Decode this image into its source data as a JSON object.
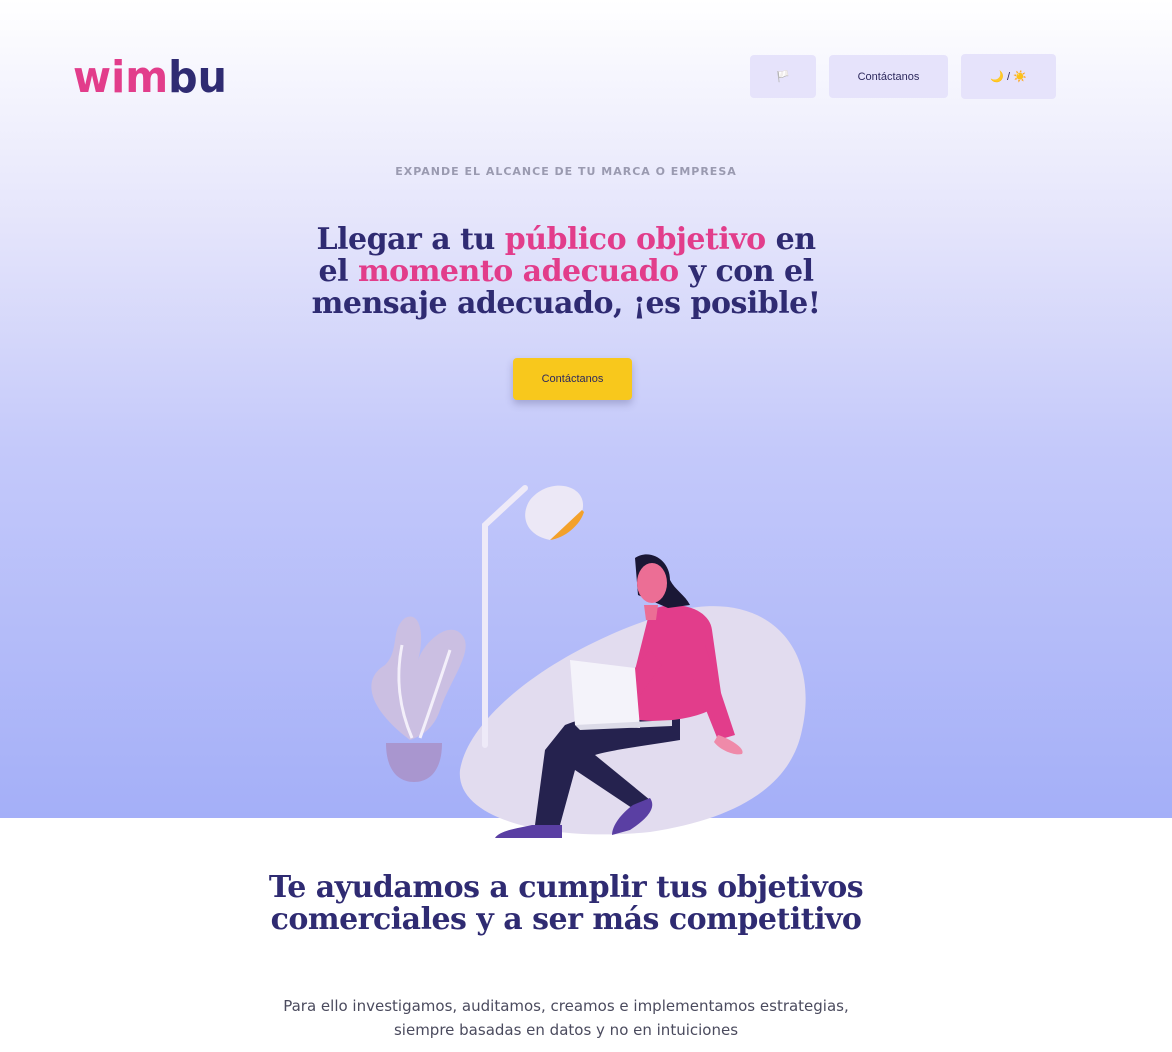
{
  "header": {
    "logo_text": "Wimbu",
    "nav": {
      "lang_icon": "flag-icon",
      "lang_glyph": "🏳️",
      "contact_label": "Contáctanos",
      "theme_toggle_label": "🌙 / ☀️"
    }
  },
  "hero": {
    "eyebrow": "EXPANDE EL ALCANCE DE TU MARCA O EMPRESA",
    "headline": {
      "part1": "Llegar a tu ",
      "highlight1": "público objetivo",
      "part2": " en el ",
      "highlight2": "momento adecuado",
      "part3": " y con el mensaje adecuado, ¡es posible!"
    },
    "cta_label": "Contáctanos",
    "illustration": "woman-with-laptop-illustration"
  },
  "section": {
    "title": "Te ayudamos a cumplir tus objetivos comerciales y a ser más competitivo",
    "text_line1": "Para ello investigamos, auditamos, creamos e implementamos estrategias,",
    "text_line2": "siempre basadas en datos y no en intuiciones"
  },
  "colors": {
    "brand_pink": "#e23d8b",
    "brand_navy": "#2f2b72",
    "cta_yellow": "#f8c81c",
    "nav_button_bg": "#e6e3fb"
  }
}
